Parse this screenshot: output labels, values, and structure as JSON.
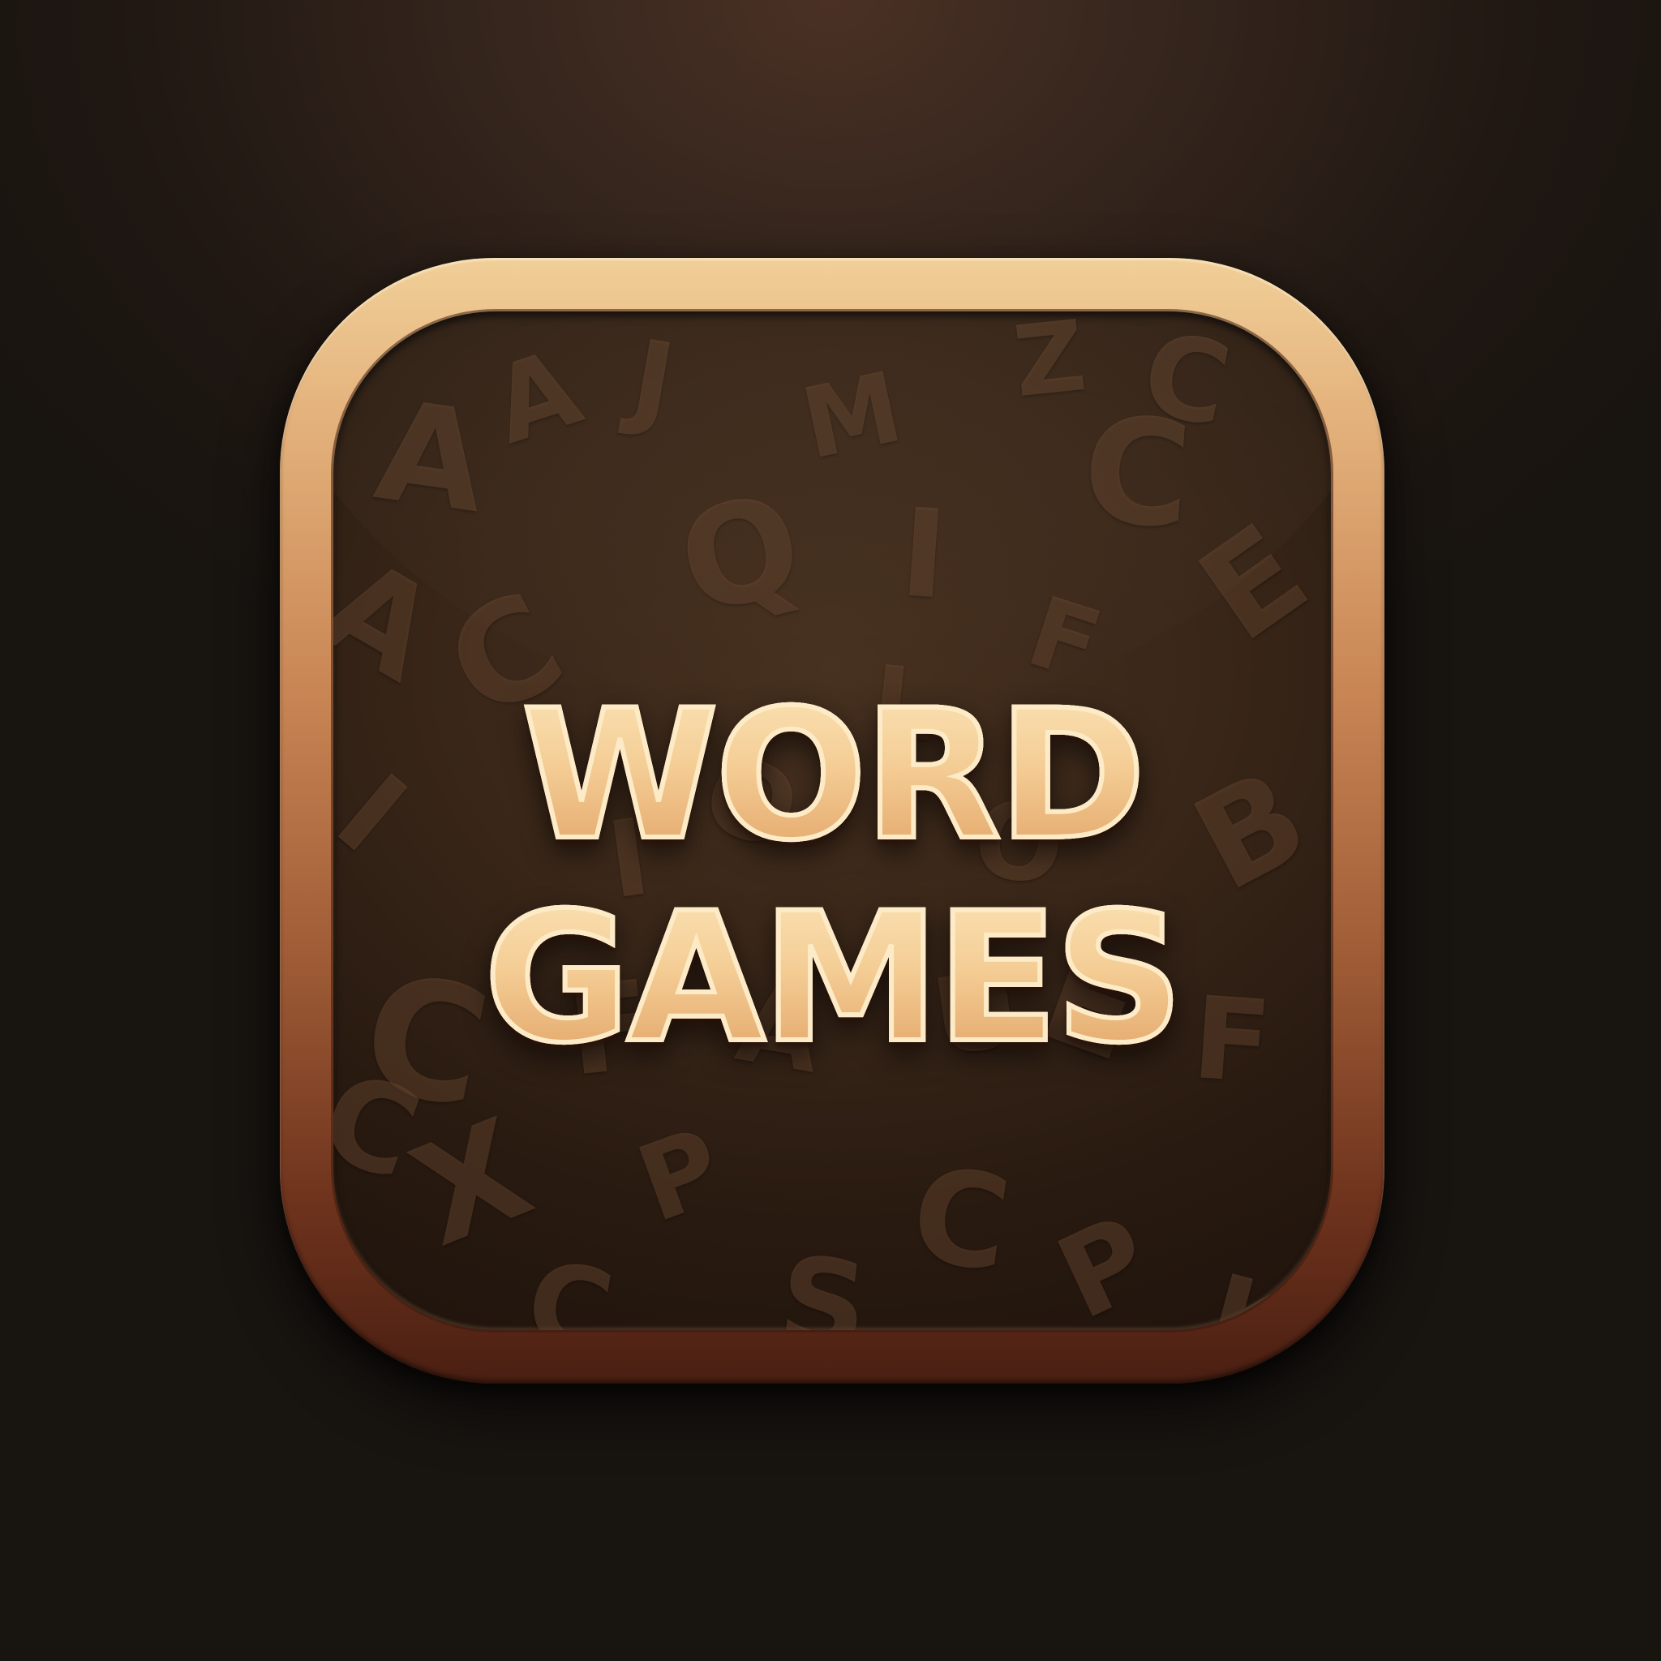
{
  "app_icon": {
    "title_line_1": "WORD",
    "title_line_2": "GAMES",
    "background_letters": [
      "A",
      "A",
      "J",
      "M",
      "Z",
      "C",
      "C",
      "Q",
      "I",
      "A",
      "C",
      "L",
      "F",
      "E",
      "I",
      "I",
      "O",
      "O",
      "B",
      "C",
      "F",
      "A",
      "U",
      "E",
      "F",
      "C",
      "X",
      "P",
      "C",
      "S",
      "C",
      "P",
      "K"
    ]
  },
  "colors": {
    "background": "#1f1712",
    "frame_light": "#f1cf98",
    "frame_dark": "#4a1f12",
    "panel": "#3a2719",
    "title_fill": "#f4cd95",
    "title_stroke": "#fdebc8",
    "background_letter": "#78523a"
  }
}
